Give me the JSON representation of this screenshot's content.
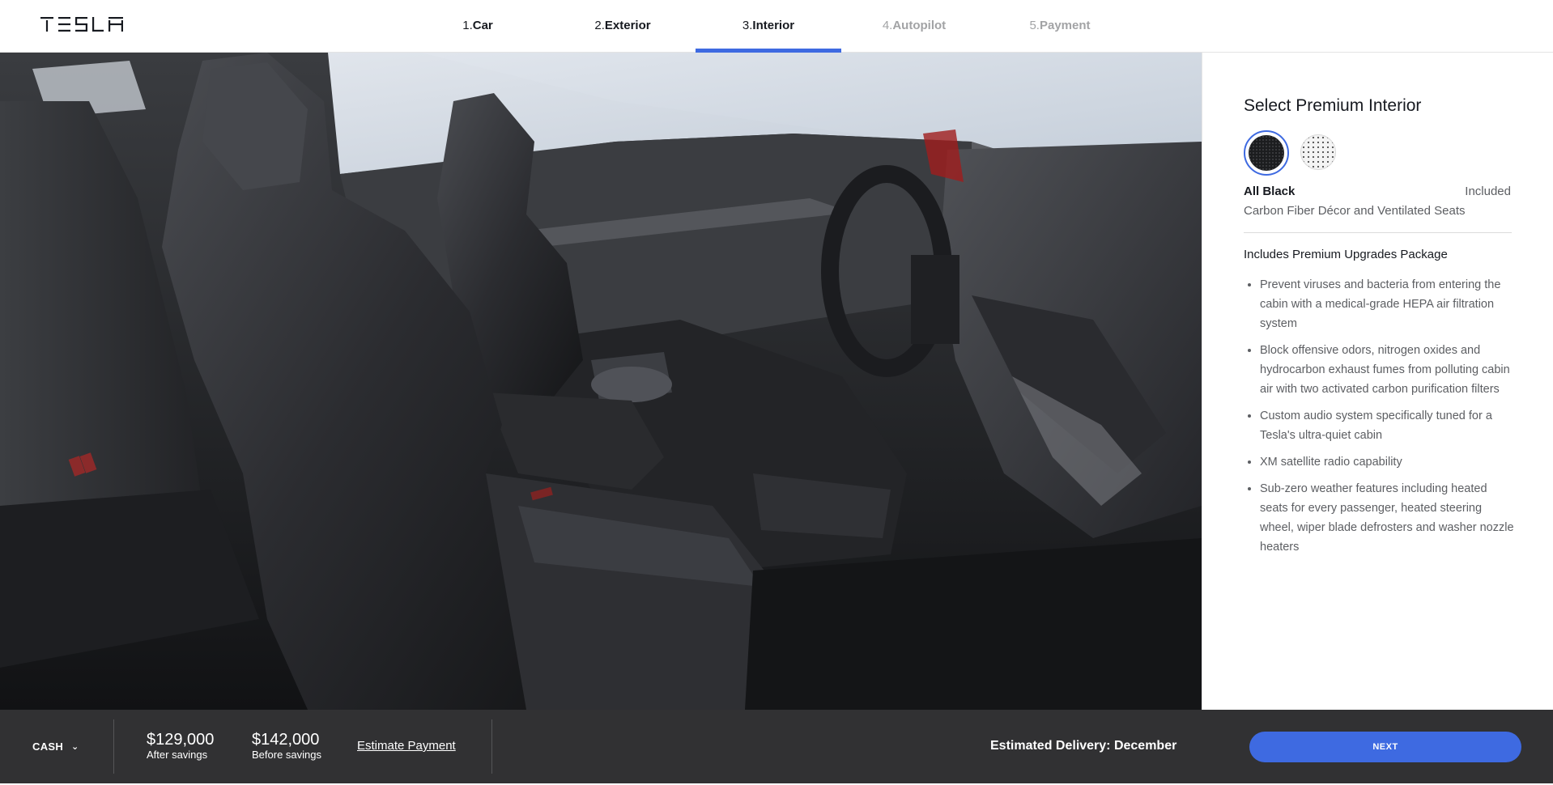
{
  "brand": {
    "logo_text": "TESLA"
  },
  "steps": [
    {
      "num": "1.",
      "label": "Car",
      "state": "done"
    },
    {
      "num": "2.",
      "label": "Exterior",
      "state": "done"
    },
    {
      "num": "3.",
      "label": "Interior",
      "state": "active"
    },
    {
      "num": "4.",
      "label": "Autopilot",
      "state": "future"
    },
    {
      "num": "5.",
      "label": "Payment",
      "state": "future"
    }
  ],
  "hero": {
    "image": "Black premium interior with front and rear leather seats"
  },
  "panel": {
    "title": "Select Premium Interior",
    "swatches": [
      {
        "name": "all-black",
        "selected": true,
        "color": "#1c1d1f"
      },
      {
        "name": "black-and-white",
        "selected": false,
        "color": "#f4f4f4"
      }
    ],
    "selected_option": {
      "name": "All Black",
      "price": "Included",
      "description": "Carbon Fiber Décor and Ventilated Seats"
    },
    "package_title": "Includes Premium Upgrades Package",
    "features": [
      "Prevent viruses and bacteria from entering the cabin with a medical-grade HEPA air filtration system",
      "Block offensive odors, nitrogen oxides and hydrocarbon exhaust fumes from polluting cabin air with two activated carbon purification filters",
      "Custom audio system specifically tuned for a Tesla's ultra-quiet cabin",
      "XM satellite radio capability",
      "Sub-zero weather features including heated seats for every passenger, heated steering wheel, wiper blade defrosters and washer nozzle heaters"
    ]
  },
  "footer": {
    "payment_type": "CASH",
    "after_savings_amount": "$129,000",
    "after_savings_label": "After savings",
    "before_savings_amount": "$142,000",
    "before_savings_label": "Before savings",
    "estimate_payment": "Estimate Payment",
    "delivery": "Estimated Delivery: December",
    "next_label": "NEXT"
  },
  "colors": {
    "accent": "#3e6ae1",
    "footer_bg": "#313133",
    "text_primary": "#171a20",
    "text_secondary": "#5c5e62",
    "step_inactive": "#a2a3a5"
  }
}
